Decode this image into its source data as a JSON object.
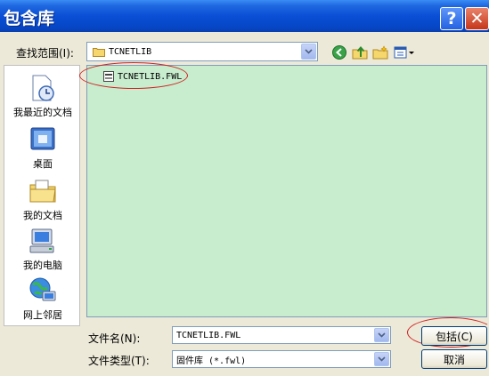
{
  "window": {
    "title": "包含库",
    "help_label": "?",
    "close_label": "✕"
  },
  "lookin": {
    "label": "查找范围(I):",
    "value": "TCNETLIB"
  },
  "places": [
    {
      "label": "我最近的文档",
      "icon": "recent-documents-icon"
    },
    {
      "label": "桌面",
      "icon": "desktop-icon"
    },
    {
      "label": "我的文档",
      "icon": "my-documents-icon"
    },
    {
      "label": "我的电脑",
      "icon": "my-computer-icon"
    },
    {
      "label": "网上邻居",
      "icon": "network-icon"
    }
  ],
  "files": [
    {
      "name": "TCNETLIB.FWL"
    }
  ],
  "filename": {
    "label": "文件名(N):",
    "value": "TCNETLIB.FWL"
  },
  "filetype": {
    "label": "文件类型(T):",
    "value": "固件库 (*.fwl)"
  },
  "buttons": {
    "include": "包括(C)",
    "cancel": "取消"
  },
  "colors": {
    "titlebar": "#0a4fd6",
    "filelist_bg": "#c8ecce",
    "highlight": "#d02020"
  }
}
